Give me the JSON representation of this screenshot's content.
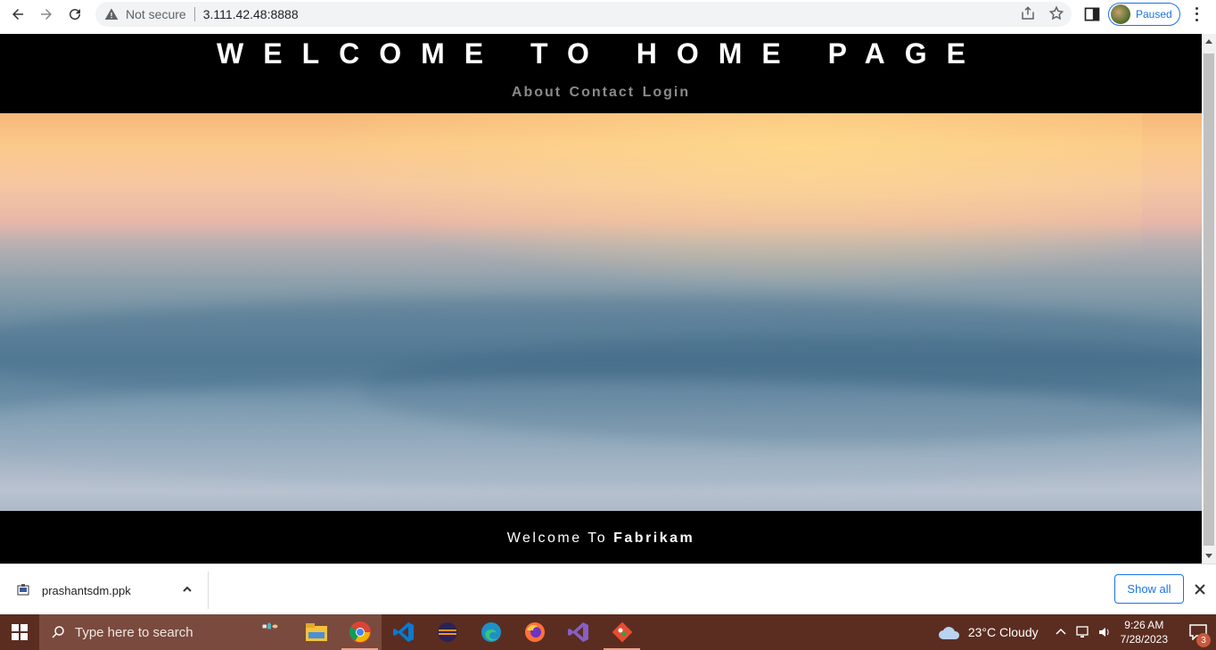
{
  "browser": {
    "security_label": "Not secure",
    "url": "3.111.42.48:8888",
    "profile_status": "Paused"
  },
  "page": {
    "heading": "WELCOME TO HOME PAGE",
    "nav": [
      "About",
      "Contact",
      "Login"
    ],
    "footer_prefix": "Welcome To",
    "footer_brand": "Fabrikam"
  },
  "downloads": {
    "file_name": "prashantsdm.ppk",
    "show_all_label": "Show all"
  },
  "taskbar": {
    "search_placeholder": "Type here to search",
    "weather": "23°C  Cloudy",
    "time": "9:26 AM",
    "date": "7/28/2023",
    "notification_count": "3"
  }
}
